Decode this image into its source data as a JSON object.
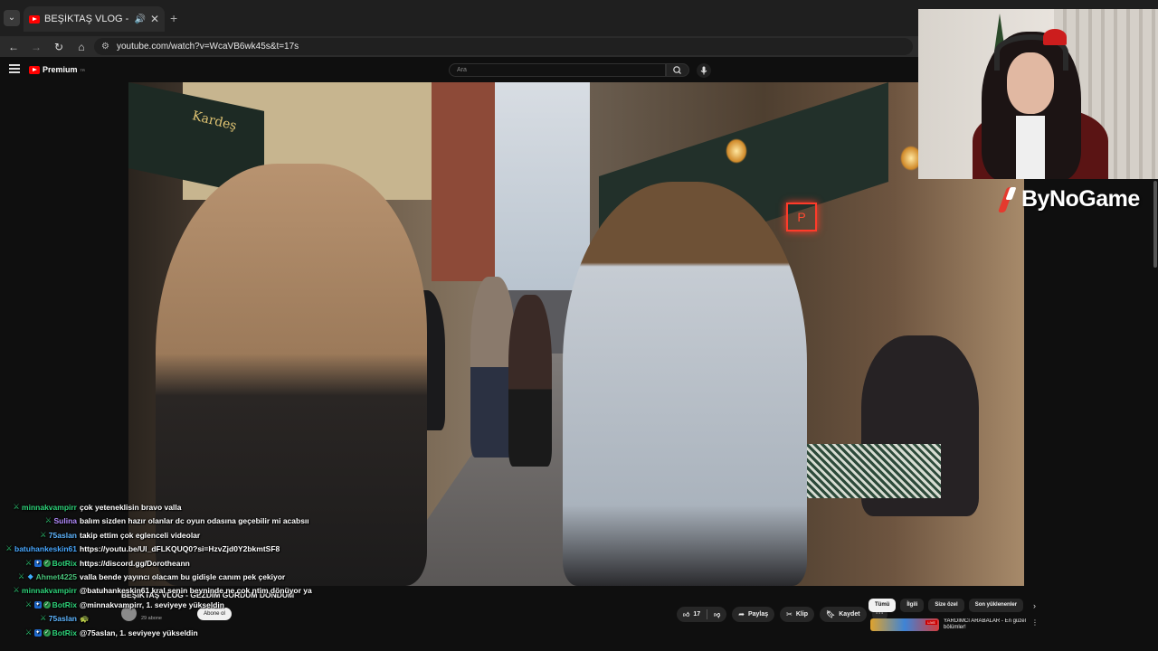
{
  "browser": {
    "tab_title": "BEŞİKTAŞ VLOG - GEZDİM GÖRDÜM",
    "url": "youtube.com/watch?v=WcaVB6wk45s&t=17s"
  },
  "youtube": {
    "logo_text": "Premium",
    "logo_sup": "TR",
    "search_placeholder": "Ara"
  },
  "video": {
    "title": "BEŞİKTAŞ VLOG - GEZDİM GÖRDÜM DÖNDÜM",
    "sign_text": "Kardeş",
    "neon_text": "P",
    "channel_name": "",
    "subscribers": "29 abone",
    "subscribe_label": "Abone ol",
    "like_count": "17",
    "share_label": "Paylaş",
    "clip_label": "Klip",
    "save_label": "Kaydet",
    "more_label": "⋯"
  },
  "overlay": {
    "brand": "ByNoGame"
  },
  "sidebar": {
    "chips": [
      "Tümü",
      "İlgili",
      "Size özel",
      "Son yüklenenler"
    ],
    "active_chip": 0,
    "rec_live_badge": "LIVE",
    "rec_title": "YARDIMCI ARABALAR - En güzel bölümler!"
  },
  "chat": [
    {
      "user": "minnakvampirr",
      "color": "#2ed47a",
      "badges": [
        "sword"
      ],
      "text": "çok yeteneklisin bravo valla"
    },
    {
      "user": "Sulina",
      "color": "#b48cff",
      "badges": [
        "sword"
      ],
      "text": "balım sizden hazır olanlar dc oyun odasına geçebilir mi acabsıı"
    },
    {
      "user": "75aslan",
      "color": "#5fb6ff",
      "badges": [
        "sword"
      ],
      "text": "takip ettim çok eglenceli videolar"
    },
    {
      "user": "batuhankeskin61",
      "color": "#49a8ff",
      "badges": [
        "sword"
      ],
      "text": "https://youtu.be/Ul_dFLKQUQ0?si=HzvZjd0Y2bkmtSF8"
    },
    {
      "user": "BotRix",
      "color": "#2ed47a",
      "badges": [
        "sword",
        "mod",
        "verified"
      ],
      "text": "https://discord.gg/Dorotheann"
    },
    {
      "user": "Ahmet4225",
      "color": "#49c37a",
      "badges": [
        "sword",
        "gem"
      ],
      "text": "valla bende yayıncı olacam bu gidişle canım pek çekiyor"
    },
    {
      "user": "minnakvampirr",
      "color": "#2ed47a",
      "badges": [
        "sword"
      ],
      "text": "@batuhankeskin61 kral senin beyninde ne çok ntim dönüyor ya"
    },
    {
      "user": "BotRix",
      "color": "#2ed47a",
      "badges": [
        "sword",
        "mod",
        "verified"
      ],
      "text": "@minnakvampirr, 1. seviyeye yükseldin"
    },
    {
      "user": "75aslan",
      "color": "#5fb6ff",
      "badges": [
        "sword"
      ],
      "text": "🐢"
    },
    {
      "user": "BotRix",
      "color": "#2ed47a",
      "badges": [
        "sword",
        "mod",
        "verified"
      ],
      "text": "@75aslan, 1. seviyeye yükseldin"
    }
  ]
}
